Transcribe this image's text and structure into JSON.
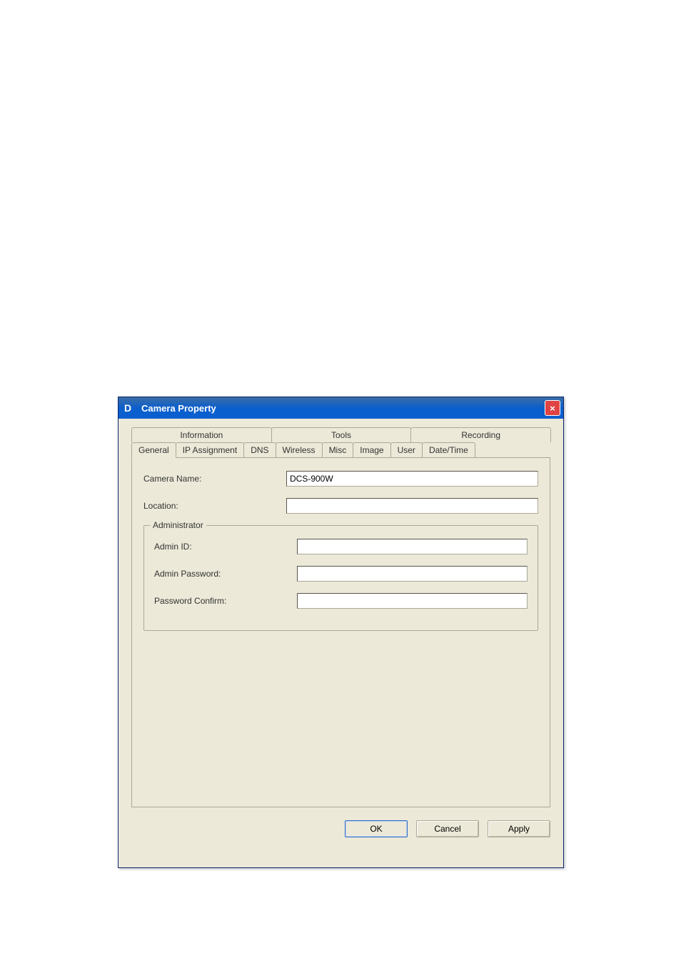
{
  "window": {
    "title": "Camera Property",
    "icon_letter": "D",
    "close_symbol": "×"
  },
  "tabs": {
    "upper": [
      {
        "label": "Information"
      },
      {
        "label": "Tools"
      },
      {
        "label": "Recording"
      }
    ],
    "lower": [
      {
        "label": "General"
      },
      {
        "label": "IP Assignment"
      },
      {
        "label": "DNS"
      },
      {
        "label": "Wireless"
      },
      {
        "label": "Misc"
      },
      {
        "label": "Image"
      },
      {
        "label": "User"
      },
      {
        "label": "Date/Time"
      }
    ]
  },
  "general": {
    "camera_name_label": "Camera Name:",
    "camera_name_value": "DCS-900W",
    "location_label": "Location:",
    "location_value": "",
    "group_title": "Administrator",
    "admin_id_label": "Admin ID:",
    "admin_id_value": "",
    "admin_password_label": "Admin Password:",
    "admin_password_value": "",
    "password_confirm_label": "Password Confirm:",
    "password_confirm_value": ""
  },
  "buttons": {
    "ok": "OK",
    "cancel": "Cancel",
    "apply": "Apply"
  }
}
